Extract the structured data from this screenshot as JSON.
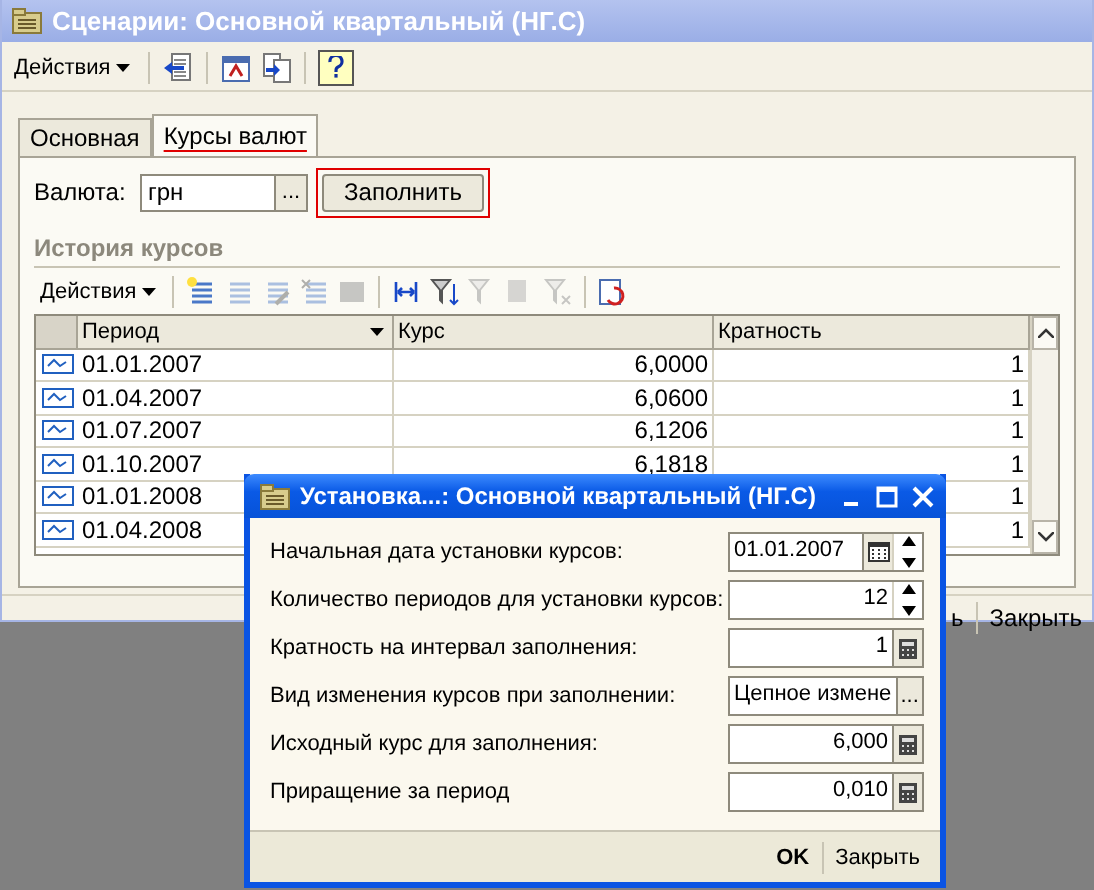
{
  "window": {
    "title": "Сценарии: Основной квартальный (НГ.С)",
    "actions_menu": "Действия"
  },
  "tabs": [
    {
      "label": "Основная",
      "selected": false
    },
    {
      "label": "Курсы валют",
      "selected": true
    }
  ],
  "currency": {
    "label": "Валюта:",
    "value": "грн",
    "select_button": "..."
  },
  "fill_button": {
    "label": "Заполнить",
    "highlighted": true
  },
  "history": {
    "title": "История курсов",
    "actions_menu": "Действия",
    "columns": [
      {
        "label": "Период",
        "sorted": true
      },
      {
        "label": "Курс",
        "sorted": false
      },
      {
        "label": "Кратность",
        "sorted": false
      }
    ],
    "rows": [
      {
        "period": "01.01.2007",
        "rate": "6,0000",
        "multiplicity": "1"
      },
      {
        "period": "01.04.2007",
        "rate": "6,0600",
        "multiplicity": "1"
      },
      {
        "period": "01.07.2007",
        "rate": "6,1206",
        "multiplicity": "1"
      },
      {
        "period": "01.10.2007",
        "rate": "6,1818",
        "multiplicity": "1"
      },
      {
        "period": "01.01.2008",
        "rate": "",
        "multiplicity": "1"
      },
      {
        "period": "01.04.2008",
        "rate": "",
        "multiplicity": "1"
      }
    ]
  },
  "footer_buttons": [
    "ь",
    "Закрыть"
  ],
  "dialog": {
    "title": "Установка...: Основной квартальный (НГ.С)",
    "fields": [
      {
        "label": "Начальная дата установки курсов:",
        "value": "01.01.2007",
        "kind": "date"
      },
      {
        "label": "Количество периодов для установки курсов:",
        "value": "12",
        "kind": "spin"
      },
      {
        "label": "Кратность на интервал заполнения:",
        "value": "1",
        "kind": "calc"
      },
      {
        "label": "Вид изменения курсов при заполнении:",
        "value": "Цепное измене",
        "kind": "choice",
        "button": "..."
      },
      {
        "label": "Исходный курс для заполнения:",
        "value": "6,000",
        "kind": "calc"
      },
      {
        "label": "Приращение за период",
        "value": "0,010",
        "kind": "calc"
      }
    ],
    "buttons": [
      {
        "label": "OK",
        "default": true
      },
      {
        "label": "Закрыть",
        "default": false
      }
    ]
  }
}
